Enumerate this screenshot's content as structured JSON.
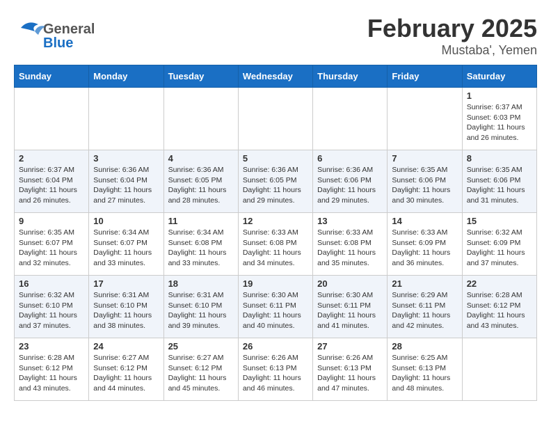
{
  "header": {
    "title": "February 2025",
    "subtitle": "Mustaba', Yemen",
    "logo_general": "General",
    "logo_blue": "Blue"
  },
  "calendar": {
    "weekdays": [
      "Sunday",
      "Monday",
      "Tuesday",
      "Wednesday",
      "Thursday",
      "Friday",
      "Saturday"
    ],
    "weeks": [
      [
        {
          "day": "",
          "info": ""
        },
        {
          "day": "",
          "info": ""
        },
        {
          "day": "",
          "info": ""
        },
        {
          "day": "",
          "info": ""
        },
        {
          "day": "",
          "info": ""
        },
        {
          "day": "",
          "info": ""
        },
        {
          "day": "1",
          "info": "Sunrise: 6:37 AM\nSunset: 6:03 PM\nDaylight: 11 hours and 26 minutes."
        }
      ],
      [
        {
          "day": "2",
          "info": "Sunrise: 6:37 AM\nSunset: 6:04 PM\nDaylight: 11 hours and 26 minutes."
        },
        {
          "day": "3",
          "info": "Sunrise: 6:36 AM\nSunset: 6:04 PM\nDaylight: 11 hours and 27 minutes."
        },
        {
          "day": "4",
          "info": "Sunrise: 6:36 AM\nSunset: 6:05 PM\nDaylight: 11 hours and 28 minutes."
        },
        {
          "day": "5",
          "info": "Sunrise: 6:36 AM\nSunset: 6:05 PM\nDaylight: 11 hours and 29 minutes."
        },
        {
          "day": "6",
          "info": "Sunrise: 6:36 AM\nSunset: 6:06 PM\nDaylight: 11 hours and 29 minutes."
        },
        {
          "day": "7",
          "info": "Sunrise: 6:35 AM\nSunset: 6:06 PM\nDaylight: 11 hours and 30 minutes."
        },
        {
          "day": "8",
          "info": "Sunrise: 6:35 AM\nSunset: 6:06 PM\nDaylight: 11 hours and 31 minutes."
        }
      ],
      [
        {
          "day": "9",
          "info": "Sunrise: 6:35 AM\nSunset: 6:07 PM\nDaylight: 11 hours and 32 minutes."
        },
        {
          "day": "10",
          "info": "Sunrise: 6:34 AM\nSunset: 6:07 PM\nDaylight: 11 hours and 33 minutes."
        },
        {
          "day": "11",
          "info": "Sunrise: 6:34 AM\nSunset: 6:08 PM\nDaylight: 11 hours and 33 minutes."
        },
        {
          "day": "12",
          "info": "Sunrise: 6:33 AM\nSunset: 6:08 PM\nDaylight: 11 hours and 34 minutes."
        },
        {
          "day": "13",
          "info": "Sunrise: 6:33 AM\nSunset: 6:08 PM\nDaylight: 11 hours and 35 minutes."
        },
        {
          "day": "14",
          "info": "Sunrise: 6:33 AM\nSunset: 6:09 PM\nDaylight: 11 hours and 36 minutes."
        },
        {
          "day": "15",
          "info": "Sunrise: 6:32 AM\nSunset: 6:09 PM\nDaylight: 11 hours and 37 minutes."
        }
      ],
      [
        {
          "day": "16",
          "info": "Sunrise: 6:32 AM\nSunset: 6:10 PM\nDaylight: 11 hours and 37 minutes."
        },
        {
          "day": "17",
          "info": "Sunrise: 6:31 AM\nSunset: 6:10 PM\nDaylight: 11 hours and 38 minutes."
        },
        {
          "day": "18",
          "info": "Sunrise: 6:31 AM\nSunset: 6:10 PM\nDaylight: 11 hours and 39 minutes."
        },
        {
          "day": "19",
          "info": "Sunrise: 6:30 AM\nSunset: 6:11 PM\nDaylight: 11 hours and 40 minutes."
        },
        {
          "day": "20",
          "info": "Sunrise: 6:30 AM\nSunset: 6:11 PM\nDaylight: 11 hours and 41 minutes."
        },
        {
          "day": "21",
          "info": "Sunrise: 6:29 AM\nSunset: 6:11 PM\nDaylight: 11 hours and 42 minutes."
        },
        {
          "day": "22",
          "info": "Sunrise: 6:28 AM\nSunset: 6:12 PM\nDaylight: 11 hours and 43 minutes."
        }
      ],
      [
        {
          "day": "23",
          "info": "Sunrise: 6:28 AM\nSunset: 6:12 PM\nDaylight: 11 hours and 43 minutes."
        },
        {
          "day": "24",
          "info": "Sunrise: 6:27 AM\nSunset: 6:12 PM\nDaylight: 11 hours and 44 minutes."
        },
        {
          "day": "25",
          "info": "Sunrise: 6:27 AM\nSunset: 6:12 PM\nDaylight: 11 hours and 45 minutes."
        },
        {
          "day": "26",
          "info": "Sunrise: 6:26 AM\nSunset: 6:13 PM\nDaylight: 11 hours and 46 minutes."
        },
        {
          "day": "27",
          "info": "Sunrise: 6:26 AM\nSunset: 6:13 PM\nDaylight: 11 hours and 47 minutes."
        },
        {
          "day": "28",
          "info": "Sunrise: 6:25 AM\nSunset: 6:13 PM\nDaylight: 11 hours and 48 minutes."
        },
        {
          "day": "",
          "info": ""
        }
      ]
    ]
  }
}
